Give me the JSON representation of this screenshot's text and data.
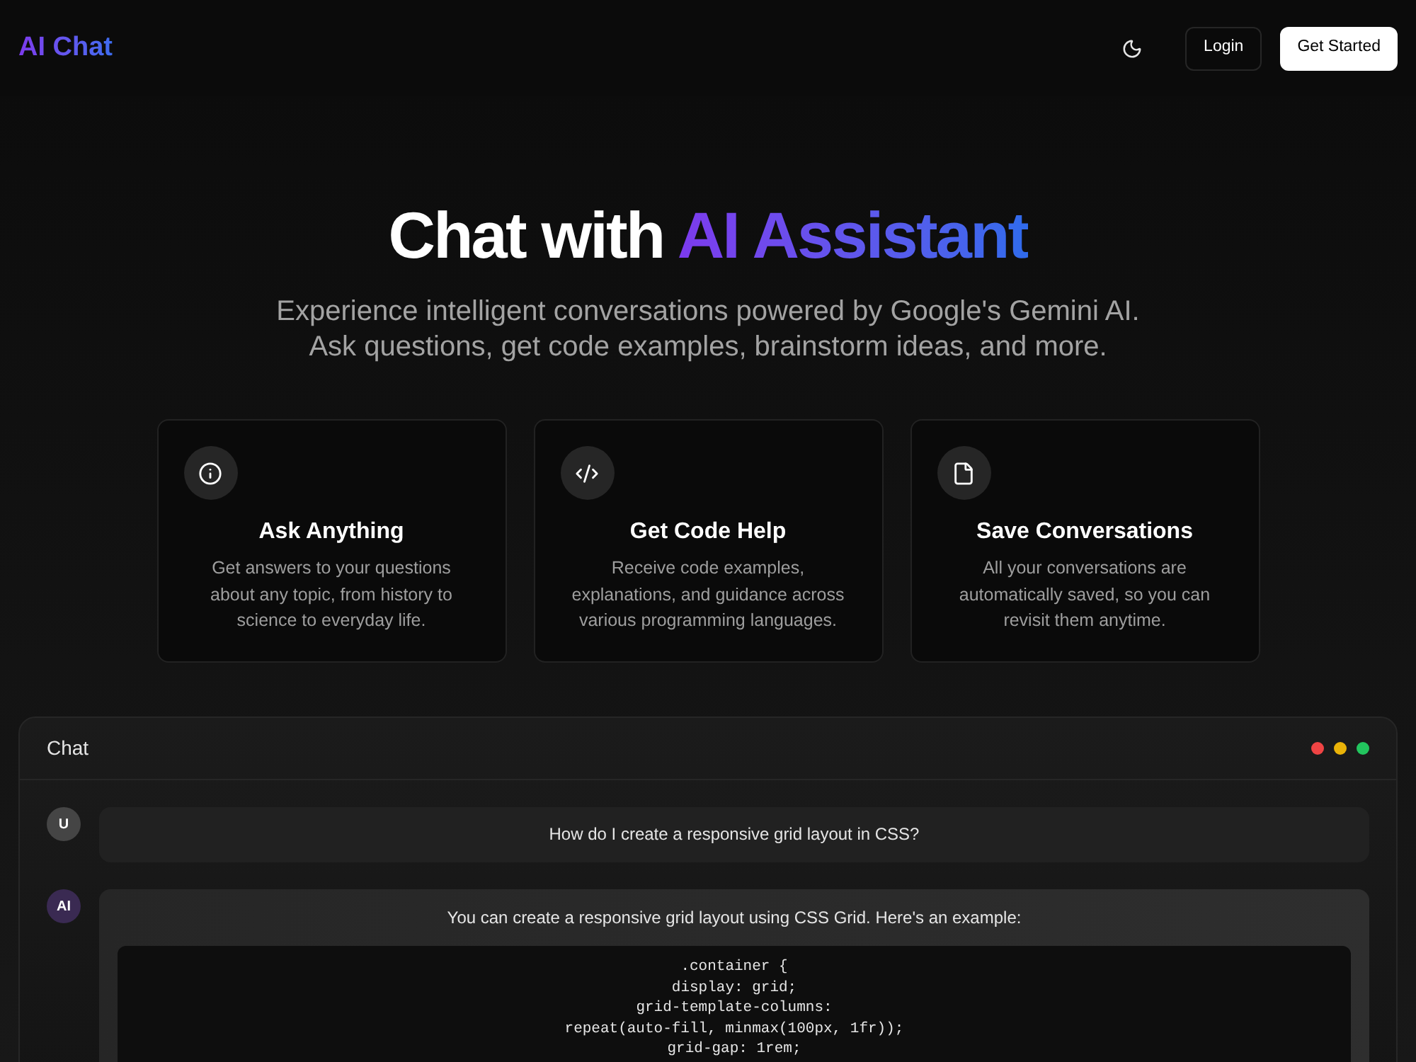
{
  "header": {
    "logo": "AI Chat",
    "buttons": [
      {
        "label": "Login",
        "kind": "outline"
      },
      {
        "label": "Get Started",
        "kind": "primary"
      }
    ]
  },
  "hero": {
    "title": {
      "lead": "Chat with",
      "highlight": "AI Assistant"
    },
    "subtitle": "Experience intelligent conversations powered by Google's Gemini AI. Ask questions, get code examples, brainstorm ideas, and more."
  },
  "features": [
    {
      "kind": "ask",
      "title": "Ask Anything",
      "description": "Get answers to your questions about any topic, from history to science to everyday life."
    },
    {
      "kind": "code",
      "title": "Get Code Help",
      "description": "Receive code examples, explanations, and guidance across various programming languages."
    },
    {
      "kind": "save",
      "title": "Save Conversations",
      "description": "All your conversations are automatically saved, so you can revisit them anytime."
    }
  ],
  "chat": {
    "title": "Chat",
    "window_dots": [
      {
        "color": "#ef4444"
      },
      {
        "color": "#eab308"
      },
      {
        "color": "#22c55e"
      }
    ],
    "messages": [
      {
        "kind": "user",
        "avatar": "U",
        "text": "How do I create a responsive grid layout in CSS?"
      },
      {
        "kind": "assistant",
        "avatar": "AI",
        "text": "You can create a responsive grid layout using CSS Grid. Here's an example:",
        "code": [
          ".container {",
          "display: grid;",
          "grid-template-columns:",
          "repeat(auto-fill, minmax(100px, 1fr));",
          "grid-gap: 1rem;"
        ]
      }
    ]
  }
}
